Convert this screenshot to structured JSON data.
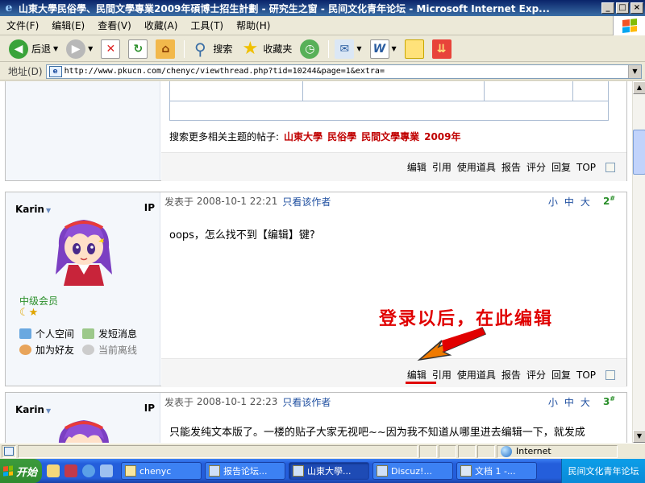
{
  "window": {
    "title": "山東大學民俗學、民間文學專業2009年碩博士招生計劃 - 研究生之窗 - 民间文化青年论坛 - Microsoft Internet Exp..."
  },
  "menu": [
    "文件(F)",
    "编辑(E)",
    "查看(V)",
    "收藏(A)",
    "工具(T)",
    "帮助(H)"
  ],
  "toolbar": {
    "back_label": "后退",
    "search_label": "搜索",
    "favorites_label": "收藏夹"
  },
  "address": {
    "label": "地址(D)",
    "url": "http://www.pkucn.com/chenyc/viewthread.php?tid=10244&page=1&extra="
  },
  "prev_post": {
    "search_more_label": "搜索更多相关主题的帖子:",
    "keywords": [
      "山東大學",
      "民俗學",
      "民間文學專業",
      "2009年"
    ]
  },
  "actions": [
    "编辑",
    "引用",
    "使用道具",
    "报告",
    "评分",
    "回复",
    "TOP"
  ],
  "posts": [
    {
      "username": "Karin",
      "ip_label": "IP",
      "rank": "中级会员",
      "stars": "☾★",
      "links": [
        "个人空间",
        "发短消息",
        "加为好友",
        "当前离线"
      ],
      "posted_label": "发表于",
      "datetime": "2008-10-1 22:21",
      "only_author": "只看该作者",
      "sizes": [
        "小",
        "中",
        "大"
      ],
      "floor": "2",
      "content": "oops，怎么找不到【编辑】键?"
    },
    {
      "username": "Karin",
      "ip_label": "IP",
      "posted_label": "发表于",
      "datetime": "2008-10-1 22:23",
      "only_author": "只看该作者",
      "sizes": [
        "小",
        "中",
        "大"
      ],
      "floor": "3",
      "content": "只能发纯文本版了。一楼的贴子大家无视吧~~因为我不知道从哪里进去编辑一下，就发成"
    }
  ],
  "annotation": "登录以后，在此编辑",
  "status": {
    "zone": "Internet"
  },
  "taskbar": {
    "start_label": "开始",
    "tasks": [
      "chenyc",
      "报告论坛...",
      "山東大學...",
      "Discuz!...",
      "文档 1 -..."
    ],
    "tray": "民间文化青年论坛"
  },
  "colors": {
    "accent_red": "#e00000",
    "link_blue": "#1f4fa0",
    "rank_green": "#2a8f2a"
  }
}
